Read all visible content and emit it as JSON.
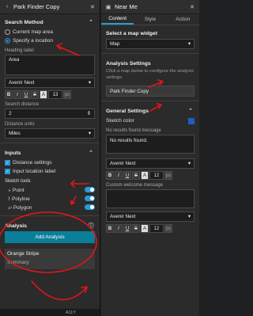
{
  "left": {
    "title": "Park Finder Copy",
    "search_method": {
      "title": "Search Method",
      "options": [
        "Current map area",
        "Specify a location"
      ],
      "heading_label": "Heading label",
      "heading_value": "Area",
      "font": "Avenir Next",
      "font_size": "13",
      "unit": "px",
      "search_distance_label": "Search distance",
      "search_distance": "2",
      "distance_units_label": "Distance units",
      "distance_units": "Miles"
    },
    "inputs": {
      "title": "Inputs",
      "items": [
        "Distance settings",
        "Input location label"
      ],
      "sketch_tools_label": "Sketch tools",
      "tools": [
        "Point",
        "Polyline",
        "Polygon"
      ]
    },
    "analysis": {
      "title": "Analysis",
      "button": "Add Analysis",
      "card_title": "Orange Stripe",
      "card_sub": "Summary"
    },
    "footer": "A11Y"
  },
  "right": {
    "title": "Near Me",
    "tabs": [
      "Content",
      "Style",
      "Action"
    ],
    "select_widget": "Select a map widget",
    "map_value": "Map",
    "analysis_settings": "Analysis Settings",
    "hint": "Click a map below to configure the analysis settings.",
    "card": "Park Finder Copy",
    "general_settings": "General Settings",
    "sketch_color": "Sketch color",
    "no_results_label": "No results found message",
    "no_results_value": "No results found.",
    "font": "Avenir Next",
    "font_size": "12",
    "unit": "px",
    "custom_welcome": "Custom welcome message",
    "accent": "#1f5fbf"
  }
}
